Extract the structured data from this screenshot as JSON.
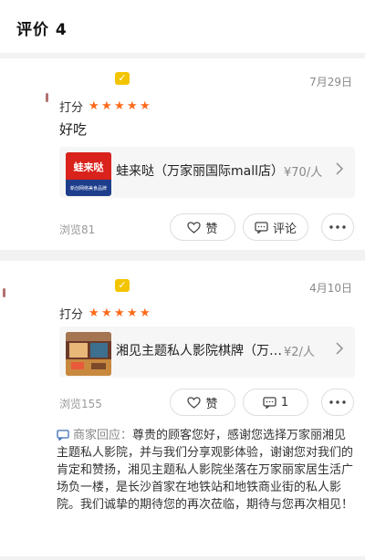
{
  "header": {
    "title": "评价 4"
  },
  "reviews": [
    {
      "date": "7月29日",
      "score_label": "打分",
      "stars": 5,
      "text": "好吃",
      "shop": {
        "name": "蛙来哒（万家丽国际mall店）",
        "price": "¥70/人",
        "thumb_text": "蛙来哒",
        "thumb_subtext": "新创网络美食品牌"
      },
      "views": "浏览81",
      "like_label": "赞",
      "comment_label": "评论"
    },
    {
      "date": "4月10日",
      "score_label": "打分",
      "stars": 5,
      "shop": {
        "name": "湘见主题私人影院棋牌（万家丽店）",
        "price": "¥2/人"
      },
      "views": "浏览155",
      "like_label": "赞",
      "comment_label": "1",
      "reply": {
        "label": "商家回应：",
        "text": "尊贵的顾客您好，感谢您选择万家丽湘见主题私人影院，并与我们分享观影体验，谢谢您对我们的肯定和赞扬，湘见主题私人影院坐落在万家丽家居生活广场负一楼，是长沙首家在地铁站和地铁商业街的私人影院。我们诚挚的期待您的再次莅临，期待与您再次相见！"
      }
    }
  ],
  "colors": {
    "star": "#ff6a1a",
    "badge": "#f2c500",
    "brand_red": "#d9221c",
    "brand_blue": "#1e3e8c"
  },
  "icons": {
    "like": "heart-icon",
    "comment": "comment-icon",
    "more": "more-dots-icon",
    "arrow": "chevron-right-icon",
    "reply": "reply-bubble-icon",
    "badge": "vip-badge-icon"
  }
}
